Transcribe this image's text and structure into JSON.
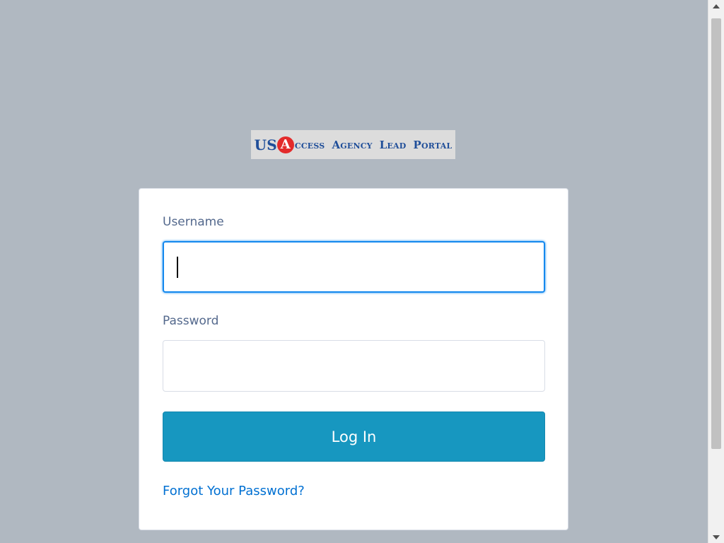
{
  "logo": {
    "text_us": "US",
    "text_a": "A",
    "text_ccess": "ccess",
    "text_agency": "Agency",
    "text_lead": "Lead",
    "text_portal": "Portal",
    "brand_color": "#1f4e99",
    "badge_color": "#e32b2b"
  },
  "form": {
    "username_label": "Username",
    "username_value": "",
    "password_label": "Password",
    "password_value": "",
    "login_label": "Log In",
    "forgot_link": "Forgot Your Password?"
  },
  "colors": {
    "background": "#b0b8c1",
    "button": "#1797c0",
    "link": "#0070d2",
    "focus": "#1589ee"
  }
}
